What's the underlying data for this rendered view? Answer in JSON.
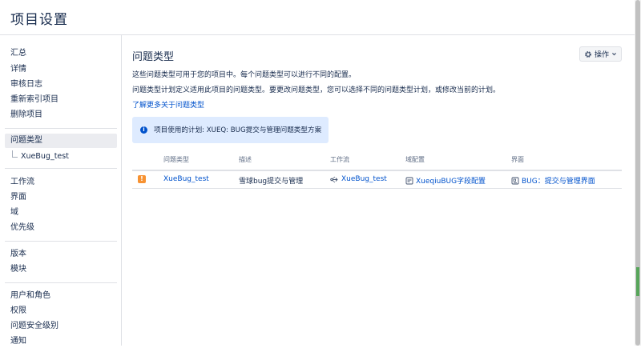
{
  "header": {
    "title": "项目设置"
  },
  "sidebar": {
    "group1": [
      "汇总",
      "详情",
      "审核日志",
      "重新索引项目",
      "删除项目"
    ],
    "group2": {
      "active": "问题类型",
      "sub": "XueBug_test"
    },
    "group3": [
      "工作流",
      "界面",
      "域",
      "优先级"
    ],
    "group4": [
      "版本",
      "模块"
    ],
    "group5": [
      "用户和角色",
      "权限",
      "问题安全级别",
      "通知"
    ]
  },
  "main": {
    "title": "问题类型",
    "operations_label": "操作",
    "desc1": "这些问题类型可用于您的项目中。每个问题类型可以进行不同的配置。",
    "desc2": "问题类型计划定义适用此项目的问题类型。要更改问题类型，您可以选择不同的问题类型计划，或修改当前的计划。",
    "learn_more": "了解更多关于问题类型",
    "scheme_info": "项目使用的计划: XUEQ: BUG提交与管理问题类型方案",
    "table": {
      "headers": [
        "问题类型",
        "描述",
        "工作流",
        "域配置",
        "界面"
      ],
      "rows": [
        {
          "issue_type": "XueBug_test",
          "description": "雪球bug提交与管理",
          "workflow": "XueBug_test",
          "field_config": "XueqiuBUG字段配置",
          "screen": "BUG：提交与管理界面"
        }
      ]
    }
  },
  "colors": {
    "accent": "#0052cc",
    "bug_icon": "#f79232",
    "info_bg": "#deebff"
  },
  "icons": [
    "gear-icon",
    "chevron-down-icon",
    "info-icon",
    "bug-type-icon",
    "workflow-icon",
    "field-config-icon",
    "screen-icon"
  ]
}
